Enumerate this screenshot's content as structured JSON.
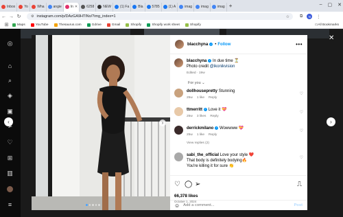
{
  "browser": {
    "tabs": [
      {
        "label": "Inbox",
        "color": "#ea4335"
      },
      {
        "label": "Yo",
        "color": "#ea4335"
      },
      {
        "label": "Wha",
        "color": "#ea4335"
      },
      {
        "label": "angie",
        "color": "#4285f4"
      },
      {
        "label": "In",
        "color": "#e1306c",
        "active": true
      },
      {
        "label": "6258",
        "color": "#555555"
      },
      {
        "label": "NEW",
        "color": "#333333"
      },
      {
        "label": "(1) Fa",
        "color": "#1877f2"
      },
      {
        "label": "Bla",
        "color": "#1877f2"
      },
      {
        "label": "5785",
        "color": "#1877f2"
      },
      {
        "label": "(1) A",
        "color": "#1877f2"
      },
      {
        "label": "imag",
        "color": "#4285f4"
      },
      {
        "label": "imag",
        "color": "#4285f4"
      },
      {
        "label": "imag",
        "color": "#4285f4"
      }
    ],
    "url": "instagram.com/p/DAzGA9HTlNo/?img_index=1",
    "profile_initial": "N",
    "bookmarks": [
      {
        "label": "Maps",
        "color": "#34a853"
      },
      {
        "label": "YouTube",
        "color": "#ff0000"
      },
      {
        "label": "Thesaurus.com",
        "color": "#f4a300"
      },
      {
        "label": "Gdrive",
        "color": "#0f9d58"
      },
      {
        "label": "Gmail",
        "color": "#ea4335"
      },
      {
        "label": "Shopify",
        "color": "#95bf47"
      },
      {
        "label": "Shopify work sheet",
        "color": "#0f9d58"
      },
      {
        "label": "Shopify",
        "color": "#95bf47"
      }
    ],
    "all_bookmarks": "All Bookmarks"
  },
  "post": {
    "username": "blacchyna",
    "follow_label": "Follow",
    "caption_lines": [
      "In due time ⏳",
      "Photo credit @ikonikvision"
    ],
    "caption_prefix": "Photo credit",
    "caption_mention": "@ikonikvision",
    "caption_first": "In due time ⏳",
    "caption_meta": "Edited · 19w",
    "for_you": "For you ⌄",
    "comments": [
      {
        "user": "dollhousepretty",
        "text": "Stunning",
        "time": "25w",
        "likes": "1 like",
        "reply": "Reply"
      },
      {
        "user": "ttmerritt",
        "text": "Love it 💝",
        "time": "25w",
        "likes": "3 likes",
        "reply": "Reply"
      },
      {
        "user": "derrickmilano",
        "text": "Wowwww 💝",
        "time": "25w",
        "likes": "1 like",
        "reply": "Reply",
        "view_replies": "View replies (2)"
      },
      {
        "user": "sabi_the_official",
        "text": "Love your style ❤️",
        "line2": "That body is definitely bodying🔥",
        "line3": "You're killing it for sure 👏"
      }
    ],
    "likes": "66,378 likes",
    "date": "October 1, 2024",
    "add_comment_placeholder": "Add a comment...",
    "post_label": "Post"
  }
}
